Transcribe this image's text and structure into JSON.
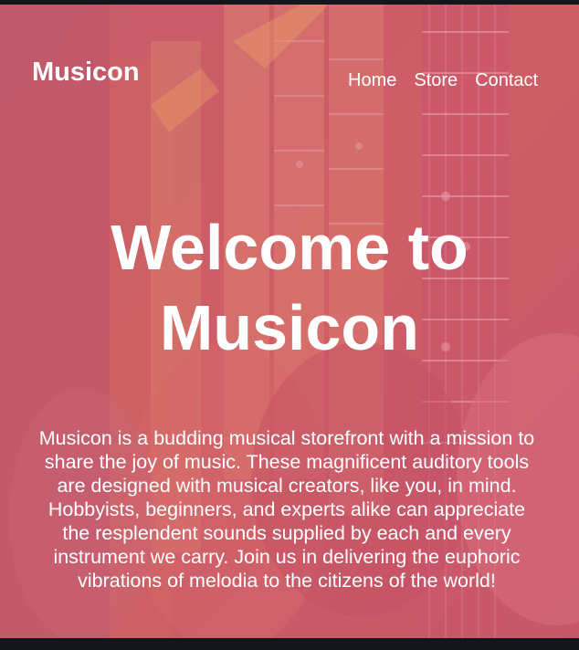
{
  "brand": {
    "name": "Musicon"
  },
  "nav": {
    "items": [
      {
        "label": "Home"
      },
      {
        "label": "Store"
      },
      {
        "label": "Contact"
      }
    ]
  },
  "hero": {
    "line1": "Welcome to",
    "line2": "Musicon",
    "description": "Musicon is a budding musical storefront with a mission to share the joy of music. These magnificent auditory tools are designed with musical creators, like you, in mind. Hobbyists, beginners, and experts alike can appreciate the resplendent sounds supplied by each and every instrument we carry. Join us in delivering the euphoric vibrations of melodia to the citizens of the world!"
  },
  "colors": {
    "overlay": "#d6546c",
    "text": "#ffffff",
    "frame": "#15151c"
  }
}
